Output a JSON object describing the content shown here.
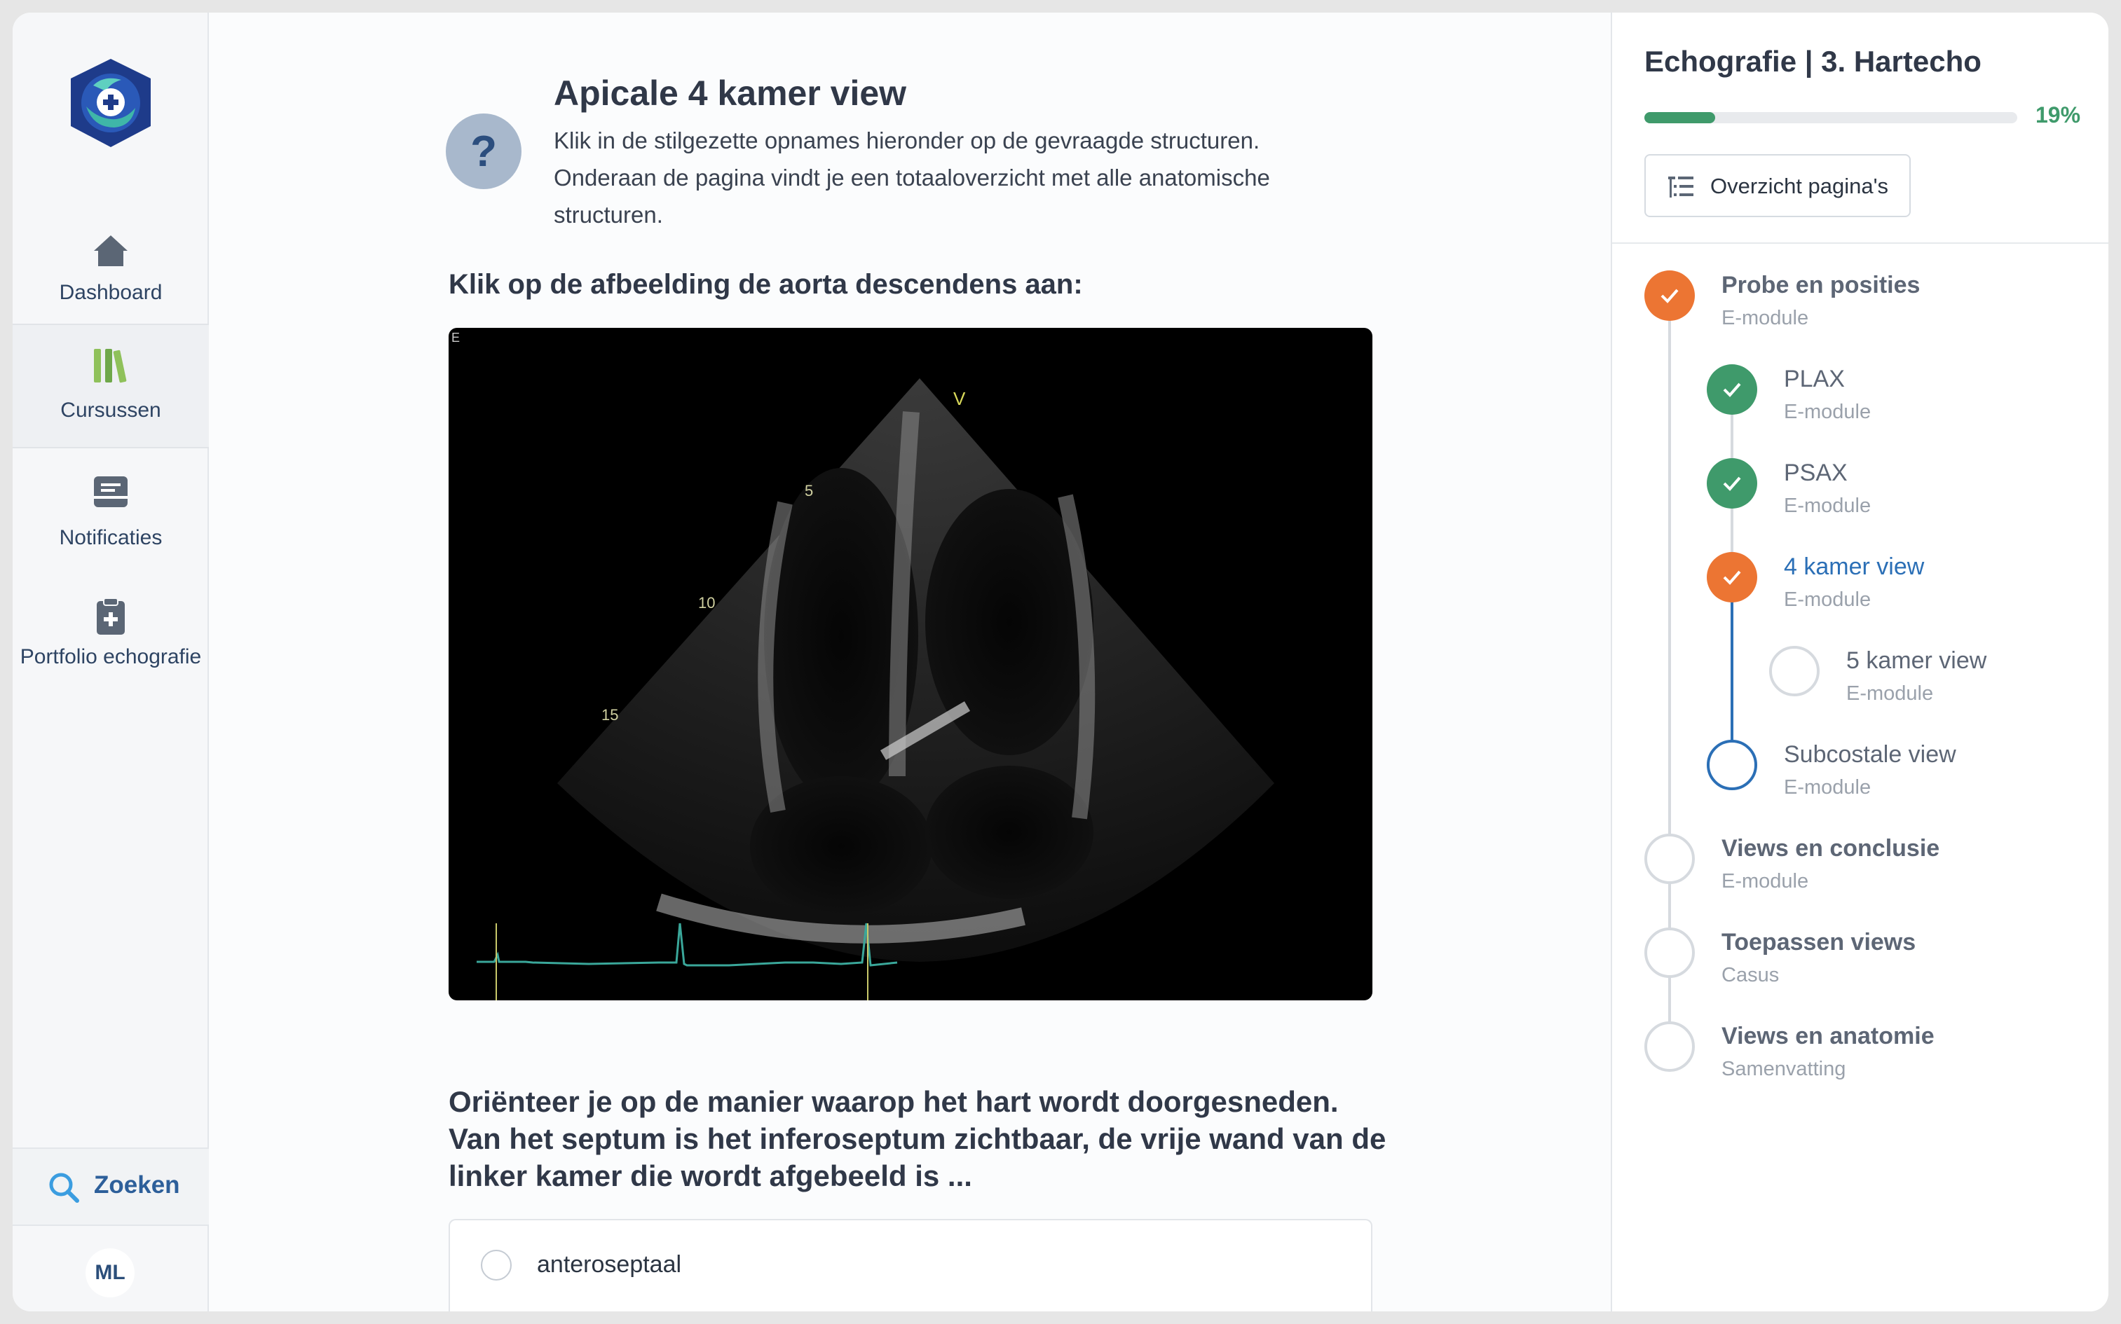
{
  "sidebar": {
    "items": [
      {
        "label": "Dashboard",
        "icon": "home-icon"
      },
      {
        "label": "Cursussen",
        "icon": "books-icon"
      },
      {
        "label": "Notificaties",
        "icon": "inbox-icon"
      },
      {
        "label": "Portfolio echografie",
        "icon": "clipboard-plus-icon"
      }
    ],
    "search_label": "Zoeken",
    "user_initials": "ML"
  },
  "header": {
    "title": "Apicale 4 kamer view",
    "description": "Klik in de stilgezette opnames hieronder op de gevraagde structuren. Onderaan de pagina vindt je een totaaloverzicht met alle anatomische structuren."
  },
  "exercise": {
    "prompt": "Klik op de afbeelding de aorta descendens aan:",
    "image_labels": {
      "probe_marker": "V",
      "depth_5": "5",
      "depth_10": "10",
      "depth_15": "15",
      "corner": "E"
    }
  },
  "question": {
    "text": "Oriënteer je op de manier waarop het hart wordt doorgesneden. Van het septum is het inferoseptum zichtbaar, de vrije wand van de linker kamer die wordt afgebeeld is ...",
    "options": [
      {
        "label": "anteroseptaal"
      }
    ]
  },
  "course": {
    "title": "Echografie | 3. Hartecho",
    "progress_percent": 19,
    "progress_label": "19%",
    "overview_button": "Overzicht pagina's",
    "steps": [
      {
        "title": "Probe en posities",
        "subtitle": "E-module",
        "status": "done-orange"
      },
      {
        "title": "PLAX",
        "subtitle": "E-module",
        "status": "done-green"
      },
      {
        "title": "PSAX",
        "subtitle": "E-module",
        "status": "done-green"
      },
      {
        "title": "4 kamer view",
        "subtitle": "E-module",
        "status": "current"
      },
      {
        "title": "5 kamer view",
        "subtitle": "E-module",
        "status": "todo"
      },
      {
        "title": "Subcostale view",
        "subtitle": "E-module",
        "status": "next"
      },
      {
        "title": "Views en conclusie",
        "subtitle": "E-module",
        "status": "todo"
      },
      {
        "title": "Toepassen views",
        "subtitle": "Casus",
        "status": "todo"
      },
      {
        "title": "Views en anatomie",
        "subtitle": "Samenvatting",
        "status": "todo"
      }
    ]
  },
  "colors": {
    "accent_orange": "#ec7533",
    "success_green": "#3f9a6b",
    "link_blue": "#2b6fb6",
    "nav_text": "#2e4463"
  }
}
